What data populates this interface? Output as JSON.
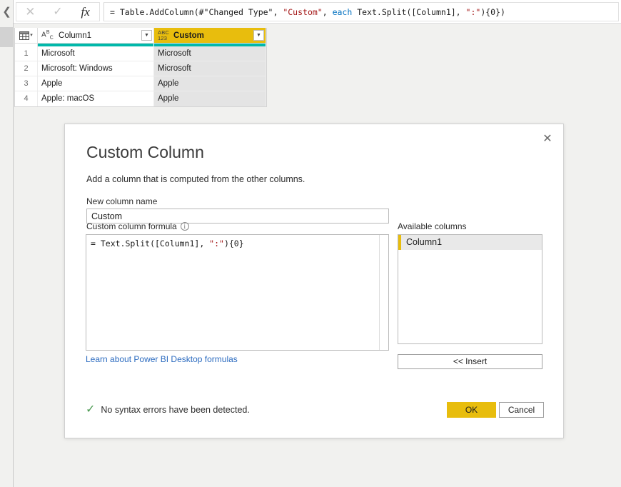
{
  "rail": {
    "collapse_icon": "chevron-left",
    "collapse_glyph": "❮"
  },
  "formula_bar": {
    "cancel_glyph": "✕",
    "commit_glyph": "✓",
    "fx_label": "fx",
    "formula_full": "= Table.AddColumn(#\"Changed Type\", \"Custom\", each Text.Split([Column1], \":\"){0})",
    "tokens": [
      {
        "text": "= Table.AddColumn(#\"Changed Type\", ",
        "kind": "plain"
      },
      {
        "text": "\"Custom\"",
        "kind": "string"
      },
      {
        "text": ", ",
        "kind": "plain"
      },
      {
        "text": "each",
        "kind": "keyword"
      },
      {
        "text": " Text.Split([Column1], ",
        "kind": "plain"
      },
      {
        "text": "\":\"",
        "kind": "string"
      },
      {
        "text": "){0})",
        "kind": "plain"
      }
    ]
  },
  "grid": {
    "corner_icon": "table-select-icon",
    "corner_caret": "▾",
    "columns": [
      {
        "name": "Column1",
        "type_icon": "abc-text-type-icon",
        "type_glyph_main": "A",
        "type_glyph_sup": "B",
        "type_glyph_sub": "C",
        "selected": false,
        "dropdown_glyph": "▼"
      },
      {
        "name": "Custom",
        "type_icon": "abc123-any-type-icon",
        "type_glyph_top": "ABC",
        "type_glyph_bottom": "123",
        "selected": true,
        "dropdown_glyph": "▼"
      }
    ],
    "rows": [
      {
        "num": "1",
        "Column1": "Microsoft",
        "Custom": "Microsoft"
      },
      {
        "num": "2",
        "Column1": "Microsoft: Windows",
        "Custom": "Microsoft"
      },
      {
        "num": "3",
        "Column1": "Apple",
        "Custom": "Apple"
      },
      {
        "num": "4",
        "Column1": "Apple: macOS",
        "Custom": "Apple"
      }
    ]
  },
  "dialog": {
    "title": "Custom Column",
    "subtitle": "Add a column that is computed from the other columns.",
    "close_glyph": "✕",
    "new_column_name_label": "New column name",
    "new_column_name_value": "Custom",
    "formula_label": "Custom column formula",
    "info_glyph": "i",
    "formula_tokens": [
      {
        "text": "= Text.Split([Column1], ",
        "kind": "plain"
      },
      {
        "text": "\":\"",
        "kind": "string"
      },
      {
        "text": "){0}",
        "kind": "plain"
      }
    ],
    "formula_value": "= Text.Split([Column1], \":\"){0}",
    "available_columns_label": "Available columns",
    "available_columns": [
      "Column1"
    ],
    "insert_label": "<< Insert",
    "learn_link": "Learn about Power BI Desktop formulas",
    "status_text": "No syntax errors have been detected.",
    "status_check_glyph": "✓",
    "ok_label": "OK",
    "cancel_label": "Cancel"
  },
  "colors": {
    "accent_yellow": "#e8bd0d",
    "quality_teal": "#01b8aa",
    "link_blue": "#2d6cc0",
    "status_green": "#4c9a52",
    "string_red": "#a31515",
    "keyword_blue": "#0070c0",
    "selected_cell_gray": "#e4e4e4",
    "canvas_gray": "#f1f1ef"
  }
}
